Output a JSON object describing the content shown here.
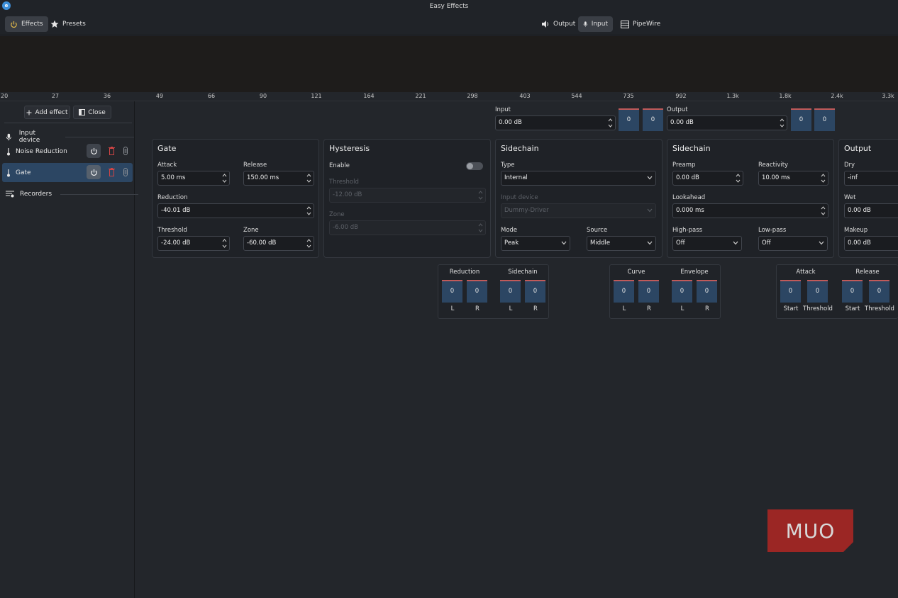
{
  "app": {
    "title": "Easy Effects",
    "logo_letter": "e"
  },
  "header": {
    "left_tabs": [
      {
        "label": "Effects",
        "icon": "power-icon",
        "active": true
      },
      {
        "label": "Presets",
        "icon": "star-icon",
        "active": false
      }
    ],
    "right_tabs": [
      {
        "label": "Output",
        "icon": "speaker-icon",
        "active": false
      },
      {
        "label": "Input",
        "icon": "microphone-icon",
        "active": true
      },
      {
        "label": "PipeWire",
        "icon": "list-icon",
        "active": false
      }
    ]
  },
  "frequency_axis": {
    "ticks": [
      "20",
      "27",
      "36",
      "49",
      "66",
      "90",
      "121",
      "164",
      "221",
      "298",
      "403",
      "544",
      "735",
      "992",
      "1.3k",
      "1.8k",
      "2.4k",
      "3.3k"
    ]
  },
  "sidebar": {
    "add_effect_label": "Add effect",
    "close_label": "Close",
    "input_device_label": "Input device",
    "plugins": [
      {
        "label": "Noise Reduction",
        "selected": false
      },
      {
        "label": "Gate",
        "selected": true
      }
    ],
    "recorders_label": "Recorders"
  },
  "io_levels": {
    "input_label": "Input",
    "input_value": "0.00 dB",
    "input_meters": [
      "0",
      "0"
    ],
    "output_label": "Output",
    "output_value": "0.00 dB",
    "output_meters": [
      "0",
      "0"
    ]
  },
  "gate_card": {
    "title": "Gate",
    "attack_label": "Attack",
    "attack_value": "5.00 ms",
    "release_label": "Release",
    "release_value": "150.00 ms",
    "reduction_label": "Reduction",
    "reduction_value": "-40.01 dB",
    "threshold_label": "Threshold",
    "threshold_value": "-24.00 dB",
    "zone_label": "Zone",
    "zone_value": "-60.00 dB"
  },
  "hysteresis_card": {
    "title": "Hysteresis",
    "enable_label": "Enable",
    "enabled": false,
    "threshold_label": "Threshold",
    "threshold_value": "-12.00 dB",
    "zone_label": "Zone",
    "zone_value": "-6.00 dB"
  },
  "sidechain_card": {
    "title": "Sidechain",
    "type_label": "Type",
    "type_value": "Internal",
    "input_device_label": "Input device",
    "input_device_value": "Dummy-Driver",
    "mode_label": "Mode",
    "mode_value": "Peak",
    "source_label": "Source",
    "source_value": "Middle"
  },
  "sidechain2_card": {
    "title": "Sidechain",
    "preamp_label": "Preamp",
    "preamp_value": "0.00 dB",
    "reactivity_label": "Reactivity",
    "reactivity_value": "10.00 ms",
    "lookahead_label": "Lookahead",
    "lookahead_value": "0.000 ms",
    "highpass_label": "High-pass",
    "highpass_value": "Off",
    "lowpass_label": "Low-pass",
    "lowpass_value": "Off"
  },
  "output_card": {
    "title": "Output",
    "dry_label": "Dry",
    "dry_value": "-inf",
    "wet_label": "Wet",
    "wet_value": "0.00 dB",
    "makeup_label": "Makeup",
    "makeup_value": "0.00 dB"
  },
  "meters": {
    "panel1": {
      "group_a": "Reduction",
      "group_b": "Sidechain",
      "values": [
        "0",
        "0",
        "0",
        "0"
      ],
      "sublabels": [
        "L",
        "R",
        "L",
        "R"
      ]
    },
    "panel2": {
      "group_a": "Curve",
      "group_b": "Envelope",
      "values": [
        "0",
        "0",
        "0",
        "0"
      ],
      "sublabels": [
        "L",
        "R",
        "L",
        "R"
      ]
    },
    "panel3": {
      "group_a": "Attack",
      "group_b": "Release",
      "values": [
        "0",
        "0",
        "0",
        "0"
      ],
      "sublabels": [
        "Start",
        "Threshold",
        "Start",
        "Threshold"
      ]
    }
  },
  "watermark": {
    "text": "MUO"
  },
  "colors": {
    "accent": "#2c4663",
    "meter_peak": "#c05a5a",
    "delete": "#d04545",
    "watermark_bg": "#9b2624"
  }
}
